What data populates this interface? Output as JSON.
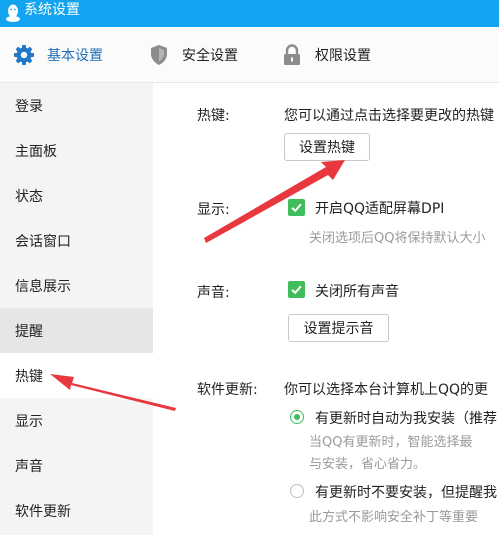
{
  "window": {
    "title": "系统设置"
  },
  "tabs": [
    {
      "label": "基本设置",
      "icon": "gear-icon",
      "active": true
    },
    {
      "label": "安全设置",
      "icon": "shield-icon",
      "active": false
    },
    {
      "label": "权限设置",
      "icon": "lock-icon",
      "active": false
    }
  ],
  "sidebar": {
    "items": [
      {
        "label": "登录"
      },
      {
        "label": "主面板"
      },
      {
        "label": "状态"
      },
      {
        "label": "会话窗口"
      },
      {
        "label": "信息展示"
      },
      {
        "label": "提醒"
      },
      {
        "label": "热键"
      },
      {
        "label": "显示"
      },
      {
        "label": "声音"
      },
      {
        "label": "软件更新"
      }
    ]
  },
  "hotkey": {
    "label": "热键:",
    "desc": "您可以通过点击选择要更改的热键",
    "button": "设置热键"
  },
  "display": {
    "label": "显示:",
    "checkbox": "开启QQ适配屏幕DPI",
    "checked": true,
    "hint": "关闭选项后QQ将保持默认大小"
  },
  "sound": {
    "label": "声音:",
    "checkbox": "关闭所有声音",
    "checked": true,
    "button": "设置提示音"
  },
  "update": {
    "label": "软件更新:",
    "desc": "你可以选择本台计算机上QQ的更",
    "option1": "有更新时自动为我安装（推荐",
    "option1_hint1": "当QQ有更新时，智能选择最",
    "option1_hint2": "与安装，省心省力。",
    "option2": "有更新时不要安装，但提醒我",
    "option2_hint": "此方式不影响安全补丁等重要"
  },
  "colors": {
    "titlebar": "#12a4f0",
    "active_tab_text": "#1f6fb7",
    "checkbox": "#3fbd5a",
    "arrow": "#e8383d"
  }
}
